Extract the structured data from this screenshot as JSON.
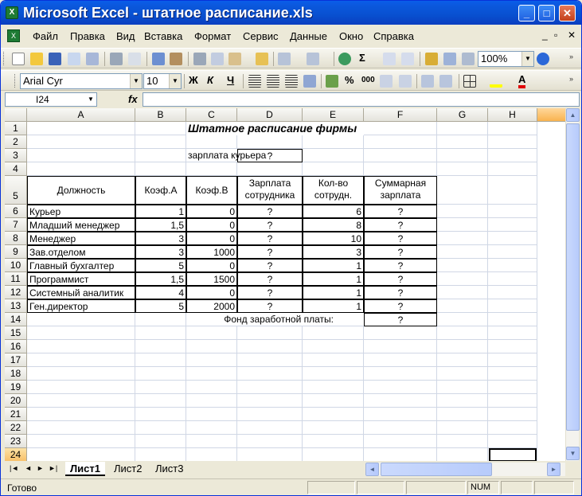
{
  "window": {
    "title": "Microsoft Excel - штатное расписание.xls",
    "app_icon_letter": "X"
  },
  "menu": [
    "Файл",
    "Правка",
    "Вид",
    "Вставка",
    "Формат",
    "Сервис",
    "Данные",
    "Окно",
    "Справка"
  ],
  "toolbar": {
    "zoom": "100%",
    "font": "Arial Cyr",
    "size": "10",
    "bold": "Ж",
    "italic": "К",
    "underline": "Ч",
    "percent": "%",
    "thousands": "000"
  },
  "formula_bar": {
    "name_box": "I24",
    "fx": "fx",
    "value": ""
  },
  "columns": [
    "A",
    "B",
    "C",
    "D",
    "E",
    "F",
    "G",
    "H"
  ],
  "rows": [
    "1",
    "2",
    "3",
    "4",
    "5",
    "6",
    "7",
    "8",
    "9",
    "10",
    "11",
    "12",
    "13",
    "14",
    "15",
    "16",
    "17",
    "18",
    "19",
    "20",
    "21",
    "22",
    "23",
    "24"
  ],
  "sheet": {
    "title": "Штатное расписание фирмы",
    "courier_label": "зарплата курьера",
    "courier_value": "?",
    "headers": {
      "position": "Должность",
      "coef_a": "Коэф.А",
      "coef_b": "Коэф.В",
      "salary_l1": "Зарплата",
      "salary_l2": "сотрудника",
      "count_l1": "Кол-во",
      "count_l2": "сотрудн.",
      "total_l1": "Суммарная",
      "total_l2": "зарплата"
    },
    "data": [
      {
        "position": "Курьер",
        "a": "1",
        "b": "0",
        "salary": "?",
        "count": "6",
        "total": "?"
      },
      {
        "position": "Младший менеджер",
        "a": "1,5",
        "b": "0",
        "salary": "?",
        "count": "8",
        "total": "?"
      },
      {
        "position": "Менеджер",
        "a": "3",
        "b": "0",
        "salary": "?",
        "count": "10",
        "total": "?"
      },
      {
        "position": "Зав.отделом",
        "a": "3",
        "b": "1000",
        "salary": "?",
        "count": "3",
        "total": "?"
      },
      {
        "position": "Главный бухгалтер",
        "a": "5",
        "b": "0",
        "salary": "?",
        "count": "1",
        "total": "?"
      },
      {
        "position": "Программист",
        "a": "1,5",
        "b": "1500",
        "salary": "?",
        "count": "1",
        "total": "?"
      },
      {
        "position": "Системный аналитик",
        "a": "4",
        "b": "0",
        "salary": "?",
        "count": "1",
        "total": "?"
      },
      {
        "position": "Ген.директор",
        "a": "5",
        "b": "2000",
        "salary": "?",
        "count": "1",
        "total": "?"
      }
    ],
    "fund_label": "Фонд заработной платы:",
    "fund_value": "?"
  },
  "sheet_tabs": [
    "Лист1",
    "Лист2",
    "Лист3"
  ],
  "status": {
    "text": "Готово",
    "num": "NUM"
  }
}
